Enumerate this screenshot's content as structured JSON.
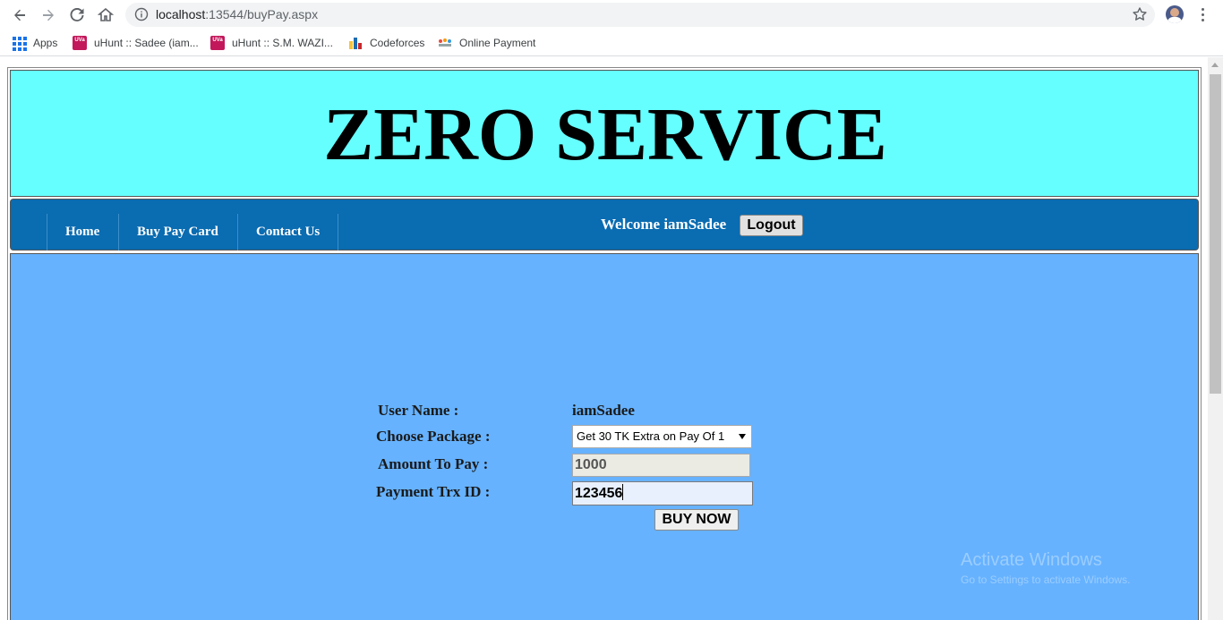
{
  "browser": {
    "url_host": "localhost",
    "url_rest": ":13544/buyPay.aspx",
    "icons": [
      "back-icon",
      "forward-icon",
      "reload-icon",
      "home-icon",
      "info-icon",
      "star-icon",
      "avatar",
      "menu-icon"
    ]
  },
  "bookmarks": [
    {
      "label": "Apps",
      "icon": "apps-grid-icon"
    },
    {
      "label": "uHunt :: Sadee (iam...",
      "icon": "uva-icon"
    },
    {
      "label": "uHunt :: S.M. WAZI...",
      "icon": "uva-icon"
    },
    {
      "label": "Codeforces",
      "icon": "codeforces-icon"
    },
    {
      "label": "Online Payment",
      "icon": "payment-icon"
    }
  ],
  "site": {
    "title": "ZERO SERVICE",
    "header_color": "#66ffff",
    "nav_color": "#0a6cb1",
    "content_color": "#66b2ff"
  },
  "nav": {
    "items": [
      "Home",
      "Buy Pay Card",
      "Contact Us"
    ],
    "welcome": "Welcome iamSadee",
    "logout": "Logout"
  },
  "form": {
    "user_name_label": "User Name :",
    "user_name_value": "iamSadee",
    "package_label": "Choose Package :",
    "package_selected": "Get 30 TK Extra on Pay Of 1",
    "amount_label": "Amount To Pay :",
    "amount_value": "1000",
    "trx_label": "Payment Trx ID :",
    "trx_value": "123456",
    "buy_button": "BUY NOW"
  },
  "watermark": {
    "title": "Activate Windows",
    "subtitle": "Go to Settings to activate Windows."
  }
}
